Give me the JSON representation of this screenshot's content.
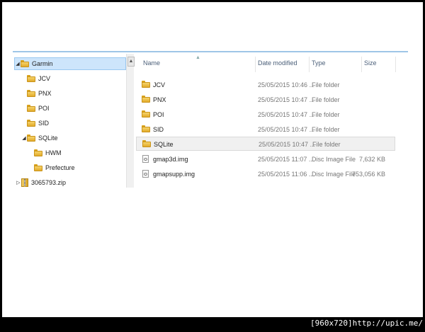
{
  "tree": {
    "items": [
      {
        "label": "Garmin",
        "caret": "◢",
        "icon": "folder-icon",
        "selected": true
      },
      {
        "label": "JCV",
        "caret": "",
        "icon": "folder-icon"
      },
      {
        "label": "PNX",
        "caret": "",
        "icon": "folder-icon"
      },
      {
        "label": "POI",
        "caret": "",
        "icon": "folder-icon"
      },
      {
        "label": "SID",
        "caret": "",
        "icon": "folder-icon"
      },
      {
        "label": "SQLite",
        "caret": "◢",
        "icon": "folder-icon"
      },
      {
        "label": "HWM",
        "caret": "",
        "icon": "folder-icon"
      },
      {
        "label": "Prefecture",
        "caret": "",
        "icon": "folder-icon"
      },
      {
        "label": "3065793.zip",
        "caret": "▷",
        "icon": "zip-icon"
      }
    ]
  },
  "columns": {
    "name": "Name",
    "date": "Date modified",
    "type": "Type",
    "size": "Size"
  },
  "files": [
    {
      "name": "JCV",
      "date": "25/05/2015 10:46 ...",
      "type": "File folder",
      "size": "",
      "icon": "folder-icon"
    },
    {
      "name": "PNX",
      "date": "25/05/2015 10:47 ...",
      "type": "File folder",
      "size": "",
      "icon": "folder-icon"
    },
    {
      "name": "POI",
      "date": "25/05/2015 10:47 ...",
      "type": "File folder",
      "size": "",
      "icon": "folder-icon"
    },
    {
      "name": "SID",
      "date": "25/05/2015 10:47 ...",
      "type": "File folder",
      "size": "",
      "icon": "folder-icon"
    },
    {
      "name": "SQLite",
      "date": "25/05/2015 10:47 ...",
      "type": "File folder",
      "size": "",
      "icon": "folder-icon",
      "selected": true
    },
    {
      "name": "gmap3d.img",
      "date": "25/05/2015 11:07 ...",
      "type": "Disc Image File",
      "size": "7,632 KB",
      "icon": "disc-image-icon"
    },
    {
      "name": "gmapsupp.img",
      "date": "25/05/2015 11:06 ...",
      "type": "Disc Image File",
      "size": "753,056 KB",
      "icon": "disc-image-icon"
    }
  ],
  "watermark": "[960x720]http://upic.me/"
}
